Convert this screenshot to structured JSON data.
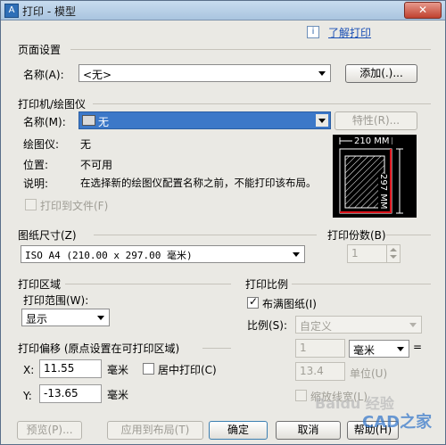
{
  "window": {
    "title": "打印 - 模型",
    "close_label": "✕"
  },
  "help": {
    "info_icon": "i",
    "link": "了解打印"
  },
  "page_setup": {
    "heading": "页面设置",
    "name_label": "名称(A):",
    "name_value": "<无>",
    "add_button": "添加(.)..."
  },
  "printer": {
    "heading": "打印机/绘图仪",
    "name_label": "名称(M):",
    "name_value": "无",
    "properties_button": "特性(R)...",
    "plotter_label": "绘图仪:",
    "plotter_value": "无",
    "location_label": "位置:",
    "location_value": "不可用",
    "description_label": "说明:",
    "description_value": "在选择新的绘图仪配置名称之前，不能打印该布局。",
    "print_to_file": "打印到文件(F)",
    "preview_width": "210 MM",
    "preview_height": "297 MM"
  },
  "paper_size": {
    "heading": "图纸尺寸(Z)",
    "value": "ISO A4 (210.00 x 297.00 毫米)"
  },
  "copies": {
    "heading": "打印份数(B)",
    "value": "1"
  },
  "plot_area": {
    "heading": "打印区域",
    "range_label": "打印范围(W):",
    "range_value": "显示"
  },
  "plot_offset": {
    "heading": "打印偏移 (原点设置在可打印区域)",
    "x_label": "X:",
    "x_value": "11.55",
    "x_unit": "毫米",
    "center_label": "居中打印(C)",
    "y_label": "Y:",
    "y_value": "-13.65",
    "y_unit": "毫米"
  },
  "plot_scale": {
    "heading": "打印比例",
    "fit_label": "布满图纸(I)",
    "fit_checked": true,
    "scale_label": "比例(S):",
    "scale_value": "自定义",
    "value1": "1",
    "unit_value": "毫米",
    "equals": "=",
    "value2": "13.4",
    "unit_label": "单位(U)",
    "lineweight_label": "缩放线宽(L)"
  },
  "buttons": {
    "preview": "预览(P)...",
    "apply": "应用到布局(T)",
    "ok": "确定",
    "cancel": "取消",
    "help": "帮助(H)"
  },
  "watermark": {
    "text1": "Baidu 经验",
    "text2": "CAD之家"
  }
}
